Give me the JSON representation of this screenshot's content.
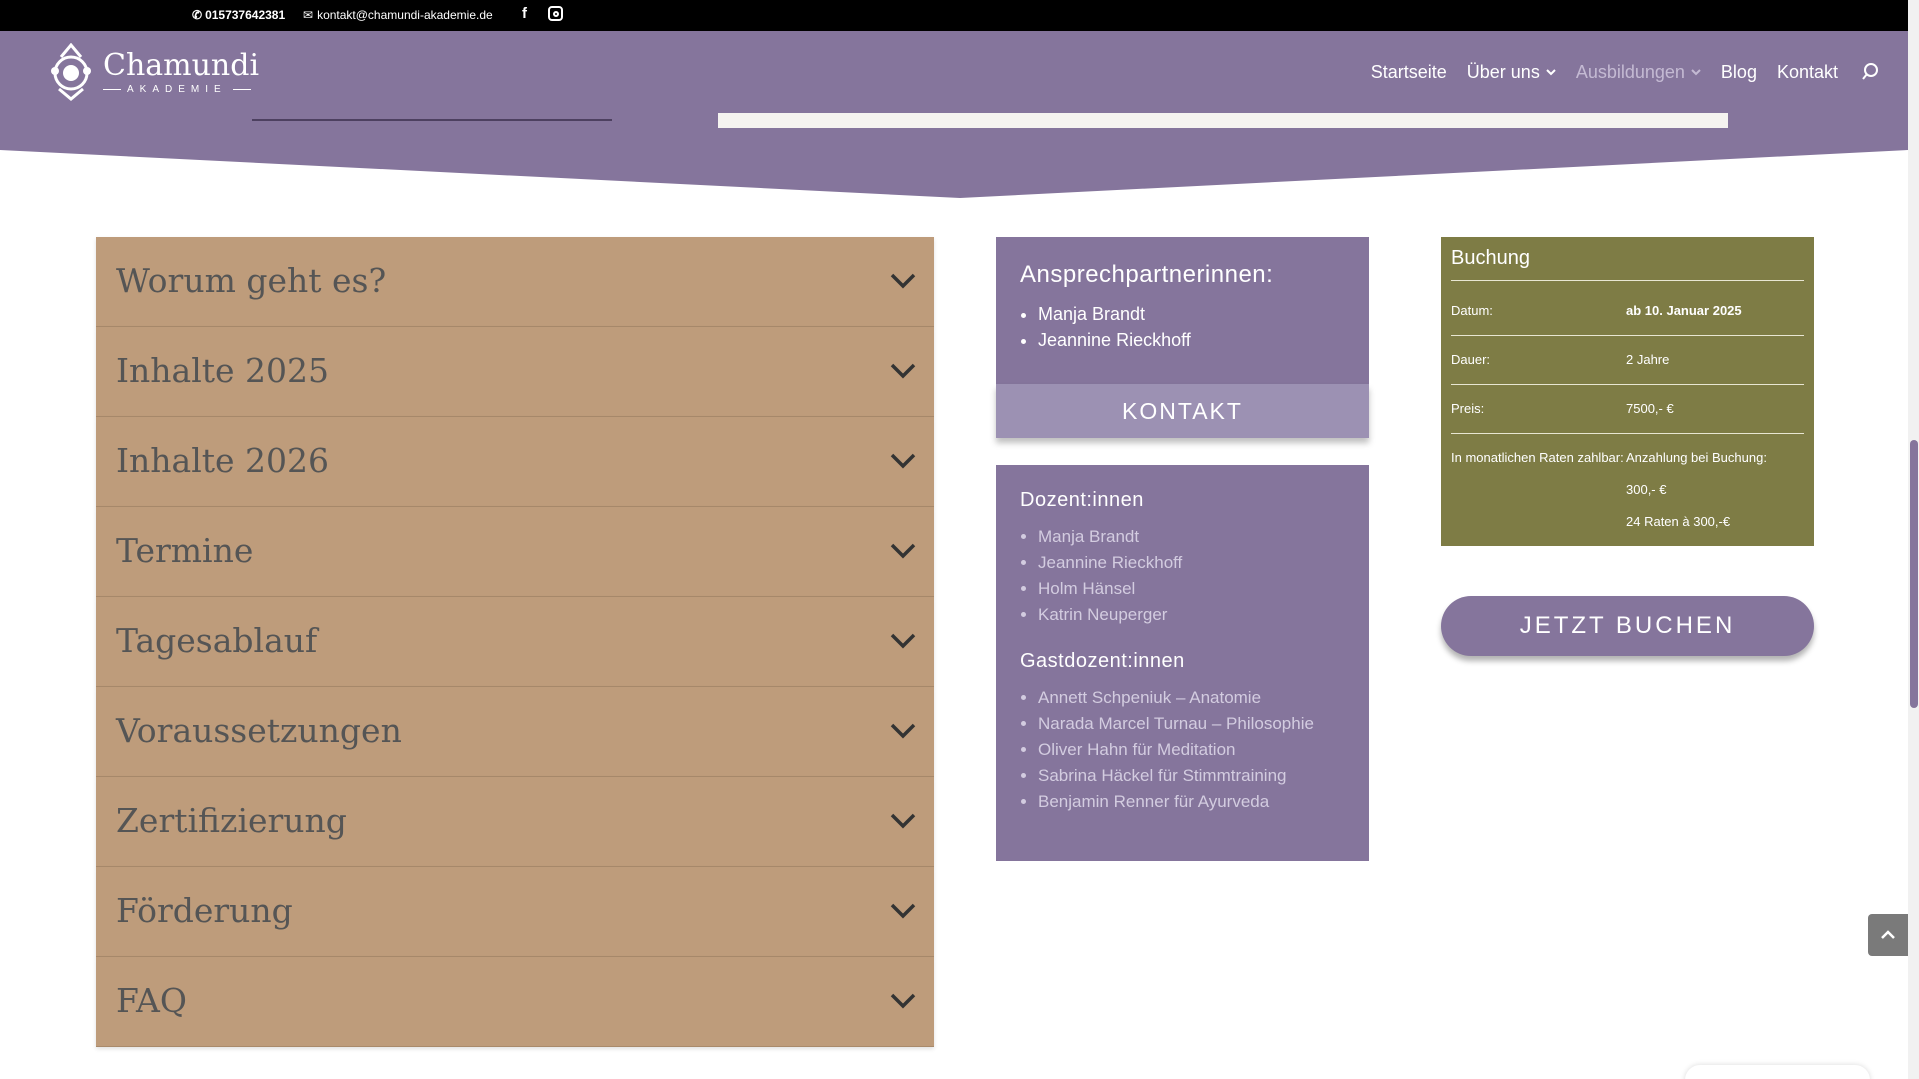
{
  "topbar": {
    "phone": "015737642381",
    "email": "kontakt@chamundi-akademie.de"
  },
  "header": {
    "logo_name": "Chamundi",
    "logo_sub": "AKADEMIE",
    "nav": [
      {
        "label": "Startseite"
      },
      {
        "label": "Über uns"
      },
      {
        "label": "Ausbildungen"
      },
      {
        "label": "Blog"
      },
      {
        "label": "Kontakt"
      }
    ]
  },
  "accordion": [
    {
      "title": "Worum geht es?"
    },
    {
      "title": "Inhalte 2025"
    },
    {
      "title": "Inhalte 2026"
    },
    {
      "title": "Termine"
    },
    {
      "title": "Tagesablauf"
    },
    {
      "title": "Voraussetzungen"
    },
    {
      "title": "Zertifizierung"
    },
    {
      "title": "Förderung"
    },
    {
      "title": "FAQ"
    }
  ],
  "contact": {
    "heading": "Ansprechpartnerinnen:",
    "people": [
      "Manja Brandt",
      "Jeannine Rieckhoff"
    ],
    "button": "KONTAKT"
  },
  "dozenten": {
    "heading": "Dozent:innen",
    "list": [
      "Manja Brandt",
      "Jeannine Rieckhoff",
      "Holm Hänsel",
      "Katrin Neuperger"
    ],
    "guest_heading": "Gastdozent:innen",
    "guests": [
      "Annett Schpeniuk – Anatomie",
      "Narada Marcel Turnau – Philosophie",
      "Oliver Hahn für Meditation",
      "Sabrina Häckel für Stimmtraining",
      "Benjamin Renner für Ayurveda"
    ]
  },
  "booking": {
    "heading": "Buchung",
    "rows": [
      {
        "label": "Datum:",
        "value": "ab 10. Januar 2025"
      },
      {
        "label": "Dauer:",
        "value": "2 Jahre"
      },
      {
        "label": "Preis:",
        "value": "7500,- €"
      }
    ],
    "rate_label": "In monatlichen Raten zahlbar:",
    "rate_lines": [
      "Anzahlung bei Buchung:",
      "300,- €",
      "24 Raten à 300,-€"
    ],
    "button": "JETZT BUCHEN"
  },
  "colors": {
    "purple": "#85759c",
    "tan": "#be9c7b",
    "olive": "#7e7c45"
  }
}
